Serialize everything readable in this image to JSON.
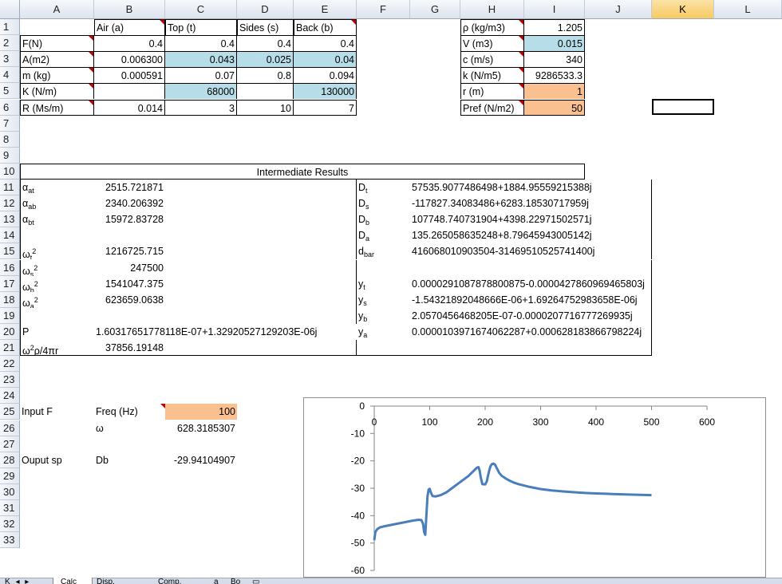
{
  "columns": [
    "A",
    "B",
    "C",
    "D",
    "E",
    "F",
    "G",
    "H",
    "I",
    "J",
    "K",
    "L"
  ],
  "rows": [
    "1",
    "2",
    "3",
    "4",
    "5",
    "6",
    "7",
    "8",
    "9",
    "10",
    "11",
    "12",
    "13",
    "14",
    "15",
    "16",
    "17",
    "18",
    "19",
    "20",
    "21",
    "22",
    "23",
    "24",
    "25",
    "26",
    "27",
    "28",
    "29",
    "30",
    "31",
    "32",
    "33"
  ],
  "params": {
    "headers": [
      "Air (a)",
      "Top (t)",
      "Sides (s)",
      "Back (b)"
    ],
    "rows": [
      {
        "label": "F(N)",
        "values": [
          "0.4",
          "0.4",
          "0.4",
          "0.4"
        ]
      },
      {
        "label": "A(m2)",
        "values": [
          "0.006300",
          "0.043",
          "0.025",
          "0.04"
        ]
      },
      {
        "label": "m (kg)",
        "values": [
          "0.000591",
          "0.07",
          "0.8",
          "0.094"
        ]
      },
      {
        "label": "K (N/m)",
        "values": [
          "",
          "68000",
          "",
          "130000"
        ]
      },
      {
        "label": "R (Ms/m)",
        "values": [
          "0.014",
          "3",
          "10",
          "7"
        ]
      }
    ]
  },
  "constants": [
    {
      "label": "ρ (kg/m3)",
      "value": "1.205"
    },
    {
      "label": "V (m3)",
      "value": "0.015"
    },
    {
      "label": "c (m/s)",
      "value": "340"
    },
    {
      "label": "k (N/m5)",
      "value": "9286533.3"
    },
    {
      "label": "r (m)",
      "value": "1"
    },
    {
      "label": "Pref (N/m2)",
      "value": "50"
    }
  ],
  "intermediate": {
    "title": "Intermediate Results",
    "left_values": [
      "2515.721871",
      "2340.206392",
      "15972.83728",
      "",
      "1216725.715",
      "247500",
      "1541047.375",
      "623659.0638",
      "",
      "1.60317651778118E-07+1.32920527129203E-06j",
      "37856.19148"
    ],
    "left_symbols": {
      "r11": "α",
      "r11s": "at",
      "r12": "α",
      "r12s": "ab",
      "r13": "α",
      "r13s": "bt",
      "r15": "ω",
      "r15s": "t",
      "r16": "ω",
      "r16s": "s",
      "r17": "ω",
      "r17s": "b",
      "r18": "ω",
      "r18s": "a",
      "r20": "P",
      "r21": "ω",
      "r21b": "ρ/4πr",
      "sq": "2"
    },
    "right_labels": {
      "r11": "D",
      "r11s": "t",
      "r12": "D",
      "r12s": "s",
      "r13": "D",
      "r13s": "b",
      "r14": "D",
      "r14s": "a",
      "r15": "d",
      "r15s": "bar",
      "r17": "y",
      "r17s": "t",
      "r18": "y",
      "r18s": "s",
      "r19": "y",
      "r19s": "b",
      "r20": "y",
      "r20s": "a"
    },
    "right_values": [
      "57535.9077486498+1884.95559215388j",
      "-117827.34083486+6283.18530717959j",
      "107748.740731904+4398.22971502571j",
      "135.265058635248+8.79645943005142j",
      "416068010903504-31469510525741400j",
      "",
      "0.0000291087878800875-0.0000427860969465803j",
      "-1.54321892048666E-06+1.69264752983658E-06j",
      "2.0570456468205E-07-0.0000207716777269935j",
      "0.0000103971674062287+0.000628183866798224j"
    ]
  },
  "inputs": {
    "input_label": "Input F",
    "freq_label": "Freq (Hz)",
    "freq_value": "100",
    "omega_label": "ω",
    "omega_value": "628.3185307",
    "output_label": "Ouput sp",
    "db_label": "Db",
    "db_value": "-29.94104907"
  },
  "chart_data": {
    "type": "line",
    "x_ticks": [
      "0",
      "100",
      "200",
      "300",
      "400",
      "500",
      "600"
    ],
    "y_ticks": [
      "0",
      "-10",
      "-20",
      "-30",
      "-40",
      "-50",
      "-60"
    ],
    "xlim": [
      0,
      600
    ],
    "ylim": [
      -60,
      0
    ],
    "grid": false,
    "color": "#4a7ebb",
    "series": [
      {
        "x": [
          0,
          2,
          5,
          10,
          20,
          30,
          40,
          50,
          60,
          70,
          80,
          85,
          88,
          90,
          92,
          94,
          96,
          98,
          100,
          102,
          105,
          110,
          120,
          130,
          140,
          150,
          160,
          170,
          175,
          180,
          185,
          188,
          190,
          192,
          195,
          200,
          203,
          205,
          208,
          210,
          212,
          215,
          218,
          220,
          223,
          225,
          230,
          240,
          250,
          260,
          280,
          300,
          320,
          350,
          380,
          400,
          430,
          460,
          500
        ],
        "y": [
          -49,
          -46,
          -45,
          -44.3,
          -43.8,
          -43.4,
          -43,
          -42.6,
          -42.2,
          -41.8,
          -41.5,
          -41.6,
          -43,
          -46,
          -47,
          -40,
          -33,
          -30.5,
          -30.2,
          -31.5,
          -32.8,
          -33,
          -32.5,
          -31.5,
          -30,
          -28.5,
          -27,
          -25.5,
          -24.5,
          -23.5,
          -22.5,
          -22.3,
          -23.5,
          -26,
          -28.5,
          -28.6,
          -27.5,
          -25.5,
          -23,
          -21.8,
          -21.2,
          -21,
          -21.4,
          -22.3,
          -23.4,
          -24.3,
          -25.5,
          -26.8,
          -27.8,
          -28.5,
          -29.5,
          -30.3,
          -30.8,
          -31.3,
          -31.7,
          -31.9,
          -32.1,
          -32.3,
          -32.5
        ]
      }
    ]
  },
  "sheet_tabs": [
    "Calc",
    "Disp.",
    "Comp.",
    "",
    "a",
    "Bo"
  ]
}
